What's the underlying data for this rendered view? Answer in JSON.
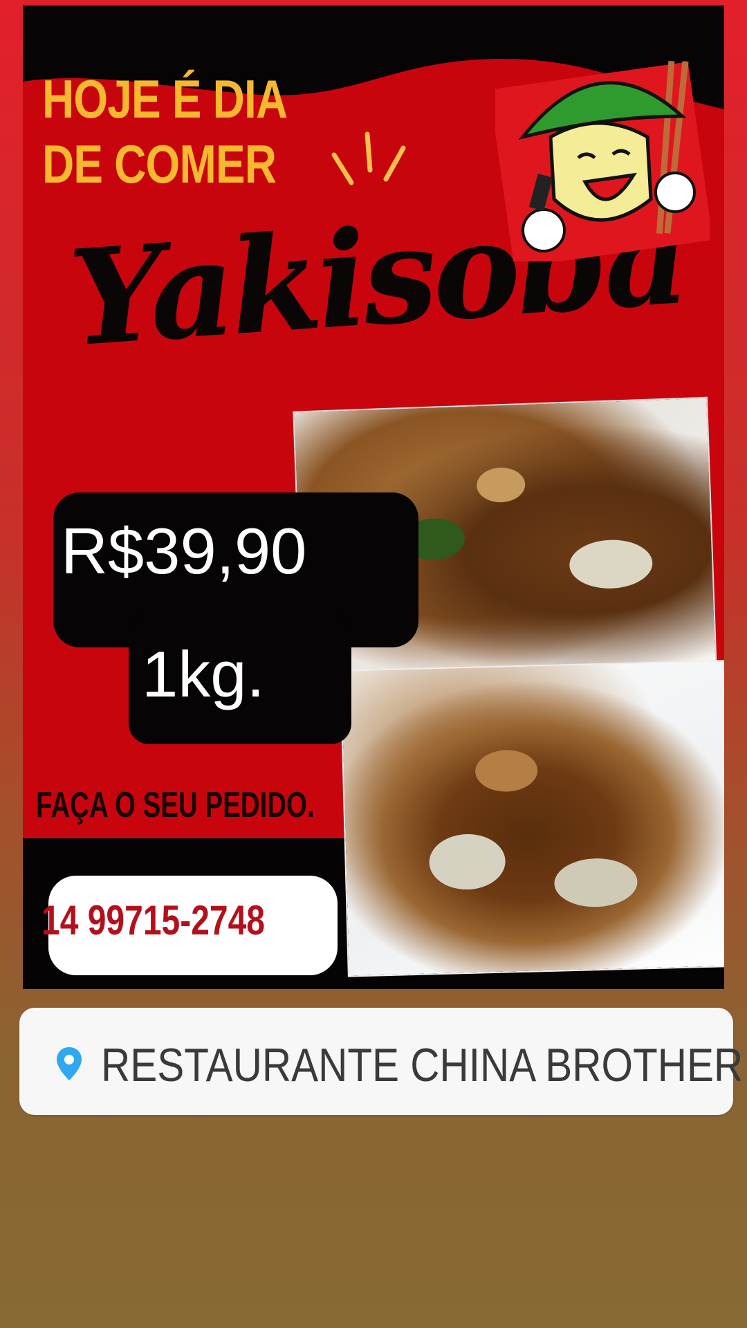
{
  "poster": {
    "headline_line1": "HOJE É DIA",
    "headline_line2": "DE COMER",
    "script_title": "Yakisoba",
    "price": "R$39,90",
    "quantity": "1kg.",
    "cta": "FAÇA O SEU PEDIDO.",
    "phone": "14 99715-2748"
  },
  "location_sticker": {
    "icon": "location-pin-icon",
    "label": "RESTAURANTE CHINA BROTHER"
  },
  "colors": {
    "poster_red": "#c8050d",
    "headline_yellow": "#f5b82e",
    "phone_red": "#b3101c",
    "pin_blue": "#2fa8f0"
  }
}
